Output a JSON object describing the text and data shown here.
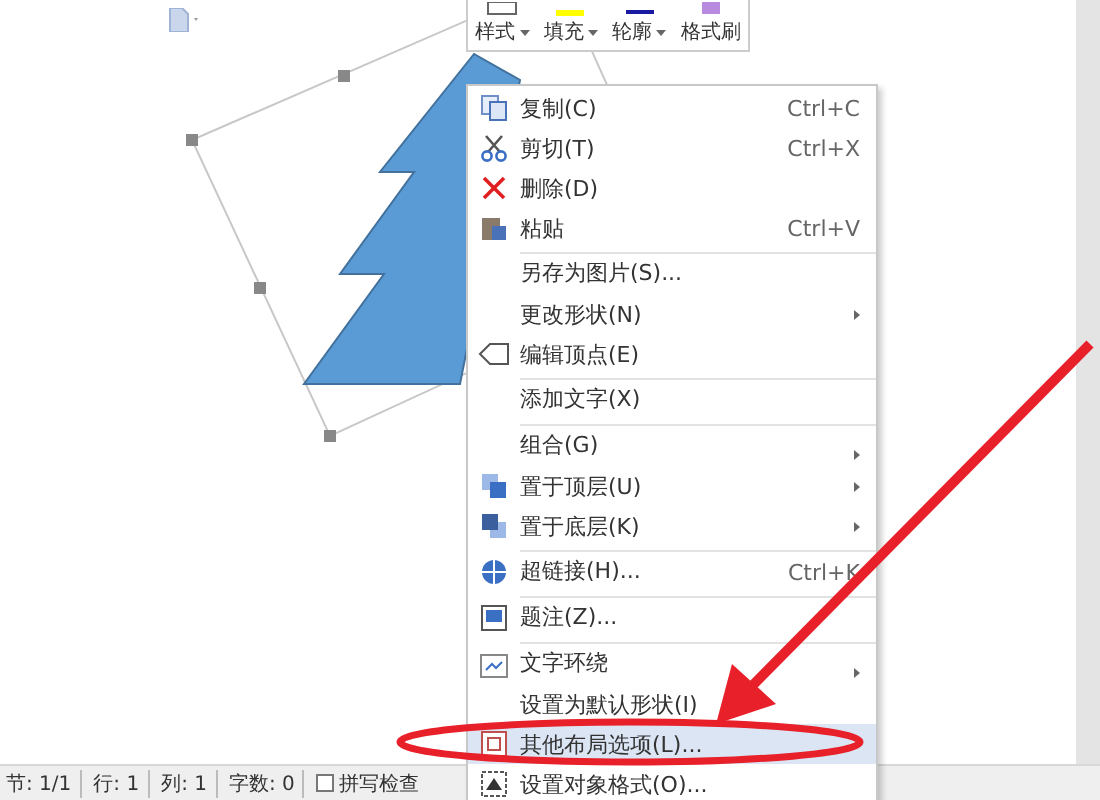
{
  "toolbar": {
    "buttons": [
      {
        "label": "样式",
        "has_dropdown": true
      },
      {
        "label": "填充",
        "has_dropdown": true
      },
      {
        "label": "轮廓",
        "has_dropdown": true
      },
      {
        "label": "格式刷",
        "has_dropdown": false
      }
    ]
  },
  "context_menu": {
    "items": [
      {
        "label": "复制(C)",
        "shortcut": "Ctrl+C",
        "has_submenu": false,
        "separator_before": false,
        "selected": false
      },
      {
        "label": "剪切(T)",
        "shortcut": "Ctrl+X",
        "has_submenu": false,
        "separator_before": false,
        "selected": false
      },
      {
        "label": "删除(D)",
        "has_submenu": false,
        "separator_before": false,
        "selected": false
      },
      {
        "label": "粘贴",
        "shortcut": "Ctrl+V",
        "has_submenu": false,
        "separator_before": false,
        "selected": false
      },
      {
        "label": "另存为图片(S)...",
        "has_submenu": false,
        "separator_before": true,
        "selected": false
      },
      {
        "label": "更改形状(N)",
        "has_submenu": true,
        "separator_before": false,
        "selected": false
      },
      {
        "label": "编辑顶点(E)",
        "has_submenu": false,
        "separator_before": false,
        "selected": false
      },
      {
        "label": "添加文字(X)",
        "has_submenu": false,
        "separator_before": true,
        "selected": false
      },
      {
        "label": "组合(G)",
        "has_submenu": true,
        "separator_before": true,
        "selected": false
      },
      {
        "label": "置于顶层(U)",
        "has_submenu": true,
        "separator_before": false,
        "selected": false
      },
      {
        "label": "置于底层(K)",
        "has_submenu": true,
        "separator_before": false,
        "selected": false
      },
      {
        "label": "超链接(H)...",
        "shortcut": "Ctrl+K",
        "has_submenu": false,
        "separator_before": true,
        "selected": false
      },
      {
        "label": "题注(Z)...",
        "has_submenu": false,
        "separator_before": true,
        "selected": false
      },
      {
        "label": "文字环绕",
        "has_submenu": true,
        "separator_before": true,
        "selected": false
      },
      {
        "label": "设置为默认形状(I)",
        "has_submenu": false,
        "separator_before": false,
        "selected": false
      },
      {
        "label": "其他布局选项(L)...",
        "has_submenu": false,
        "separator_before": false,
        "selected": true
      },
      {
        "label": "设置对象格式(O)...",
        "has_submenu": false,
        "separator_before": false,
        "selected": false
      }
    ]
  },
  "status_bar": {
    "fields": [
      "节: 1/1",
      "行: 1",
      "列: 1",
      "字数: 0"
    ],
    "spell_check": {
      "label": "拼写检查",
      "checked": false
    }
  }
}
